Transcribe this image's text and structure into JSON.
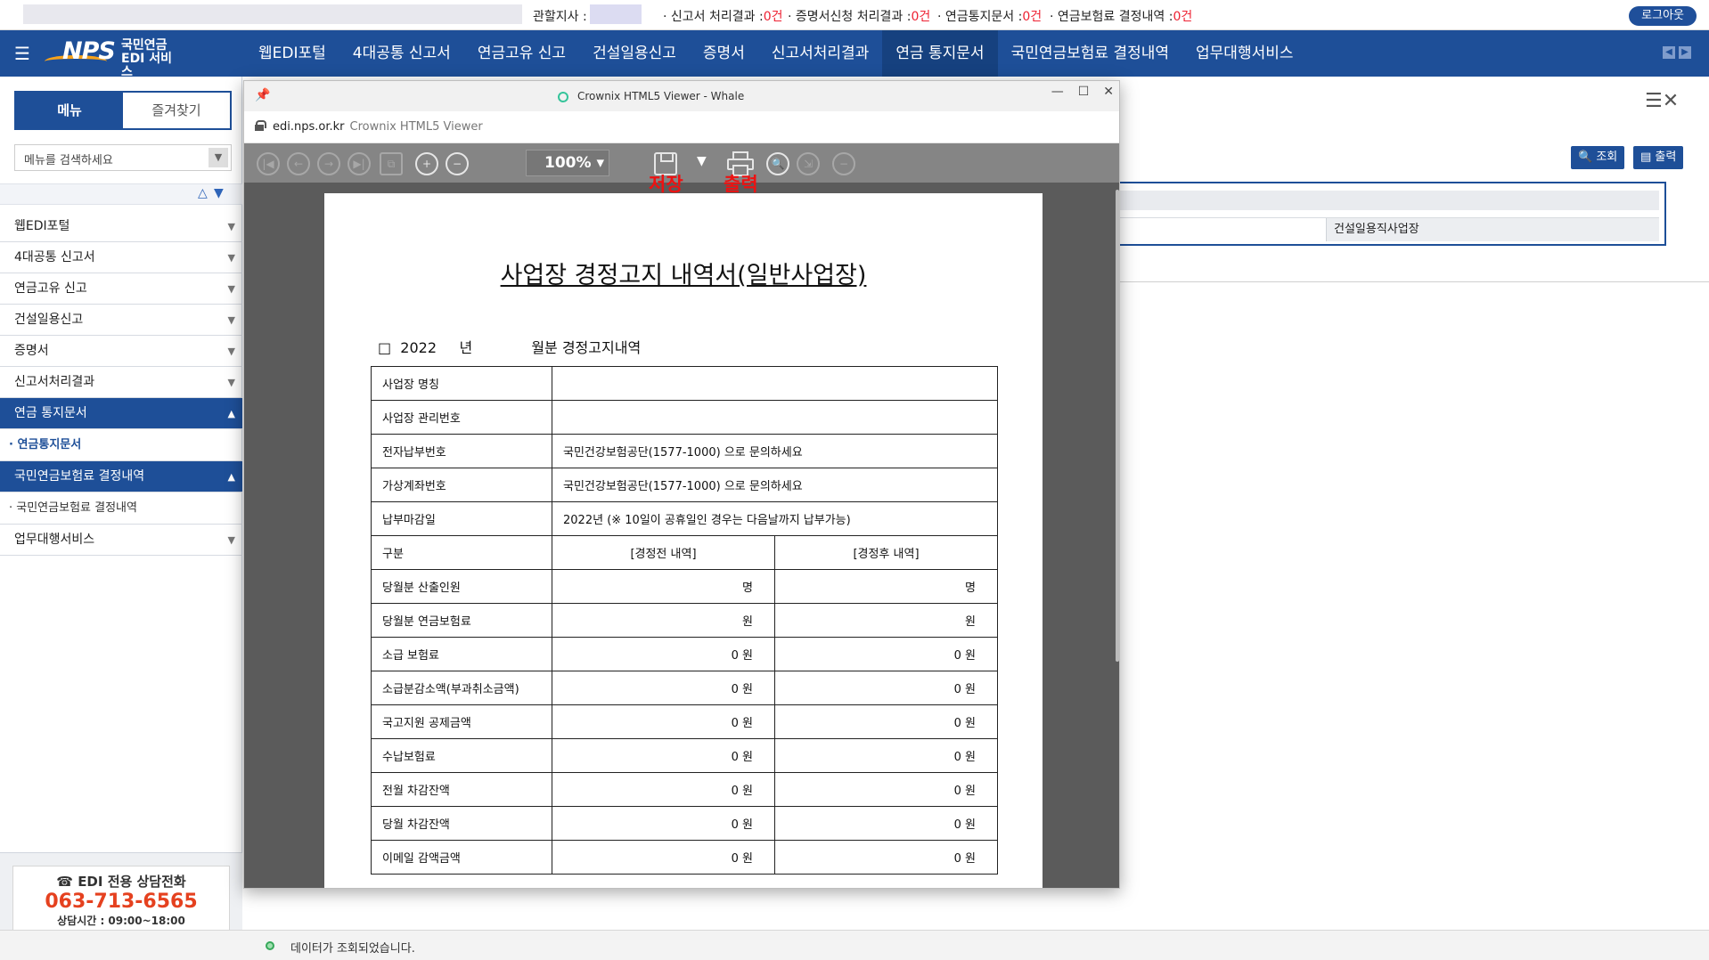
{
  "topbar": {
    "office_label": "관할지사 :",
    "items": [
      {
        "label": "신고서 처리결과 :",
        "count": "0건"
      },
      {
        "label": "증명서신청 처리결과 :",
        "count": "0건"
      },
      {
        "label": "연금통지문서 :",
        "count": "0건"
      },
      {
        "label": "연금보험료 결정내역 :",
        "count": "0건"
      }
    ],
    "logout": "로그아웃"
  },
  "nav": {
    "logo": {
      "brand": "NPS",
      "line1": "국민연금",
      "line2": "EDI 서비스"
    },
    "items": [
      "웹EDI포털",
      "4대공통 신고서",
      "연금고유 신고",
      "건설일용신고",
      "증명서",
      "신고서처리결과",
      "연금 통지문서",
      "국민연금보험료 결정내역",
      "업무대행서비스"
    ],
    "active_index": 6
  },
  "sidebar": {
    "tabs": [
      "메뉴",
      "즐겨찾기"
    ],
    "search_placeholder": "메뉴를 검색하세요",
    "rows": [
      {
        "label": "웹EDI포털"
      },
      {
        "label": "4대공통 신고서"
      },
      {
        "label": "연금고유 신고"
      },
      {
        "label": "건설일용신고"
      },
      {
        "label": "증명서"
      },
      {
        "label": "신고서처리결과"
      },
      {
        "label": "연금 통지문서",
        "sub": "연금통지문서"
      },
      {
        "label": "국민연금보험료 결정내역",
        "sub": "국민연금보험료 결정내역"
      },
      {
        "label": "업무대행서비스"
      }
    ],
    "contact": {
      "title": "EDI 전용 상담전화",
      "phone": "063-713-6565",
      "hours": "상담시간 : 09:00~18:00"
    }
  },
  "content": {
    "search_btn": "조회",
    "print_btn": "출력",
    "grid_value": "건설일용직사업장"
  },
  "status": {
    "message": "데이터가 조회되었습니다."
  },
  "viewer": {
    "window_title": "Crownix HTML5 Viewer - Whale",
    "url": "edi.nps.or.kr",
    "url_title": "Crownix HTML5 Viewer",
    "zoom": "100%",
    "annotations": {
      "save": "저장",
      "print": "출력"
    },
    "annotation_color": "#ee1111"
  },
  "document": {
    "title": "사업장 경정고지 내역서(일반사업장)",
    "period_box": "□",
    "year": "2022",
    "year_suffix": "년",
    "month_text": "월분 경정고지내역",
    "rows": [
      {
        "label": "사업장 명칭",
        "value": ""
      },
      {
        "label": "사업장 관리번호",
        "value": ""
      },
      {
        "label": "전자납부번호",
        "value": "국민건강보험공단(1577-1000) 으로 문의하세요"
      },
      {
        "label": "가상계좌번호",
        "value": "국민건강보험공단(1577-1000) 으로 문의하세요"
      },
      {
        "label": "납부마감일",
        "value": "2022년",
        "note": "(※ 10일이 공휴일인 경우는 다음날까지 납부가능)"
      }
    ],
    "compare_header": {
      "label": "구분",
      "before": "[경정전 내역]",
      "after": "[경정후 내역]"
    },
    "compare_rows": [
      {
        "label": "당월분 산출인원",
        "before": "명",
        "after": "명"
      },
      {
        "label": "당월분 연금보험료",
        "before": "원",
        "after": "원"
      },
      {
        "label": "소급 보험료",
        "before": "0  원",
        "after": "0  원"
      },
      {
        "label": "소급분감소액(부과취소금액)",
        "before": "0  원",
        "after": "0  원"
      },
      {
        "label": "국고지원 공제금액",
        "before": "0  원",
        "after": "0  원"
      },
      {
        "label": "수납보험료",
        "before": "0  원",
        "after": "0  원"
      },
      {
        "label": "전월 차감잔액",
        "before": "0  원",
        "after": "0  원"
      },
      {
        "label": "당월 차감잔액",
        "before": "0  원",
        "after": "0  원"
      },
      {
        "label": "이메일 감액금액",
        "before": "0  원",
        "after": "0  원"
      }
    ]
  }
}
